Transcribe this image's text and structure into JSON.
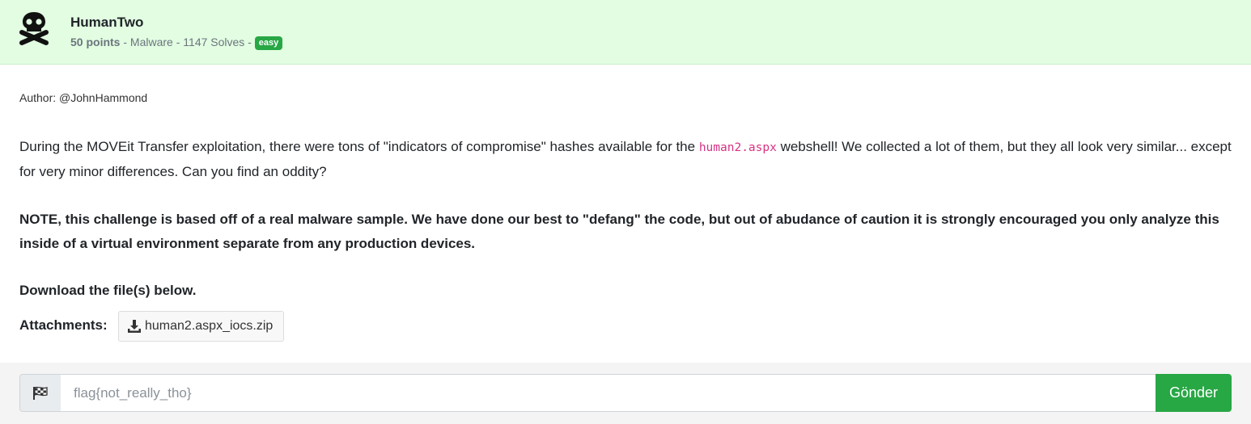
{
  "challenge": {
    "title": "HumanTwo",
    "points": "50 points",
    "sep1": " - ",
    "category": "Malware",
    "sep2": " - ",
    "solves": "1147 Solves",
    "sep3": " - ",
    "difficulty": "easy",
    "icon": "skull-crossbones-icon"
  },
  "body": {
    "author": "Author: @JohnHammond",
    "desc_before": "During the MOVEit Transfer exploitation, there were tons of \"indicators of compromise\" hashes available for the ",
    "desc_code": "human2.aspx",
    "desc_after": " webshell! We collected a lot of them, but they all look very similar... except for very minor differences. Can you find an oddity?",
    "note": "NOTE, this challenge is based off of a real malware sample. We have done our best to \"defang\" the code, but out of abudance of caution it is strongly encouraged you only analyze this inside of a virtual environment separate from any production devices.",
    "download": "Download the file(s) below.",
    "attachments_label": "Attachments:",
    "attachment_file": "human2.aspx_iocs.zip"
  },
  "submit_form": {
    "placeholder": "flag{not_really_tho}",
    "value": "",
    "button_label": "Gönder",
    "addon_icon": "checkered-flag-icon"
  },
  "colors": {
    "header_bg": "#e2fde2",
    "badge_green": "#28a745",
    "code_pink": "#d63384",
    "footer_bg": "#f4f4f4"
  }
}
